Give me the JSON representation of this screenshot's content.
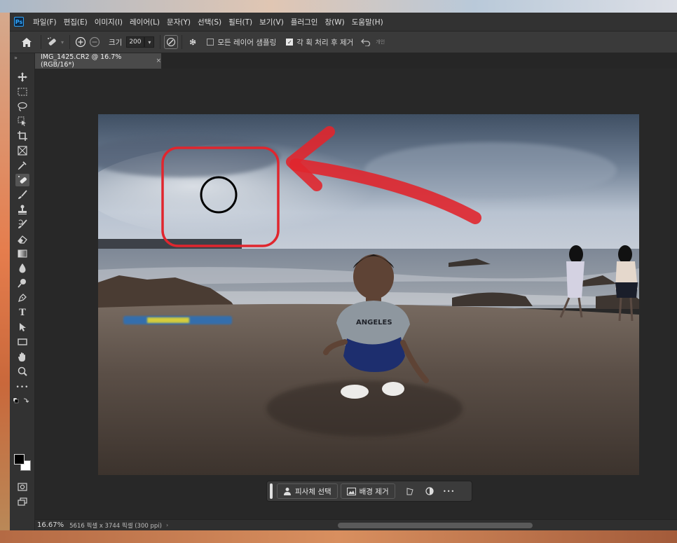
{
  "menu": {
    "logo": "Ps",
    "items": [
      "파일(F)",
      "편집(E)",
      "이미지(I)",
      "레이어(L)",
      "문자(Y)",
      "선택(S)",
      "필터(T)",
      "보기(V)",
      "플러그인",
      "창(W)",
      "도움말(H)"
    ]
  },
  "options": {
    "size_label": "크기",
    "size_value": "200",
    "sample_all_label": "모든 레이어 샘플링",
    "sample_all_checked": false,
    "remove_after_label": "각 획 처리 후 제거",
    "remove_after_checked": true,
    "extra_label": "개인"
  },
  "document": {
    "tab_title": "IMG_1425.CR2 @ 16.7% (RGB/16*)",
    "close_glyph": "×"
  },
  "taskbar": {
    "select_subject": "피사체 선택",
    "remove_background": "배경 제거",
    "more": "•••"
  },
  "status": {
    "zoom": "16.67%",
    "doc_info": "5616 픽셀 x 3744 픽셀 (300 ppi)",
    "arrow": "›"
  },
  "toolbar": {
    "collapse": "»",
    "more_tools": "•••",
    "type_tool": "T"
  },
  "colors": {
    "app_bg": "#2b2b2b",
    "menubar_bg": "#323232",
    "annotation_red": "#e0262e",
    "brush_cursor": "#000000",
    "foreground": "#000000",
    "background": "#ffffff"
  },
  "icons": [
    "home-icon",
    "spot-healing-brush-icon",
    "add-icon",
    "subtract-icon",
    "pressure-icon",
    "settings-icon",
    "undo-icon"
  ]
}
